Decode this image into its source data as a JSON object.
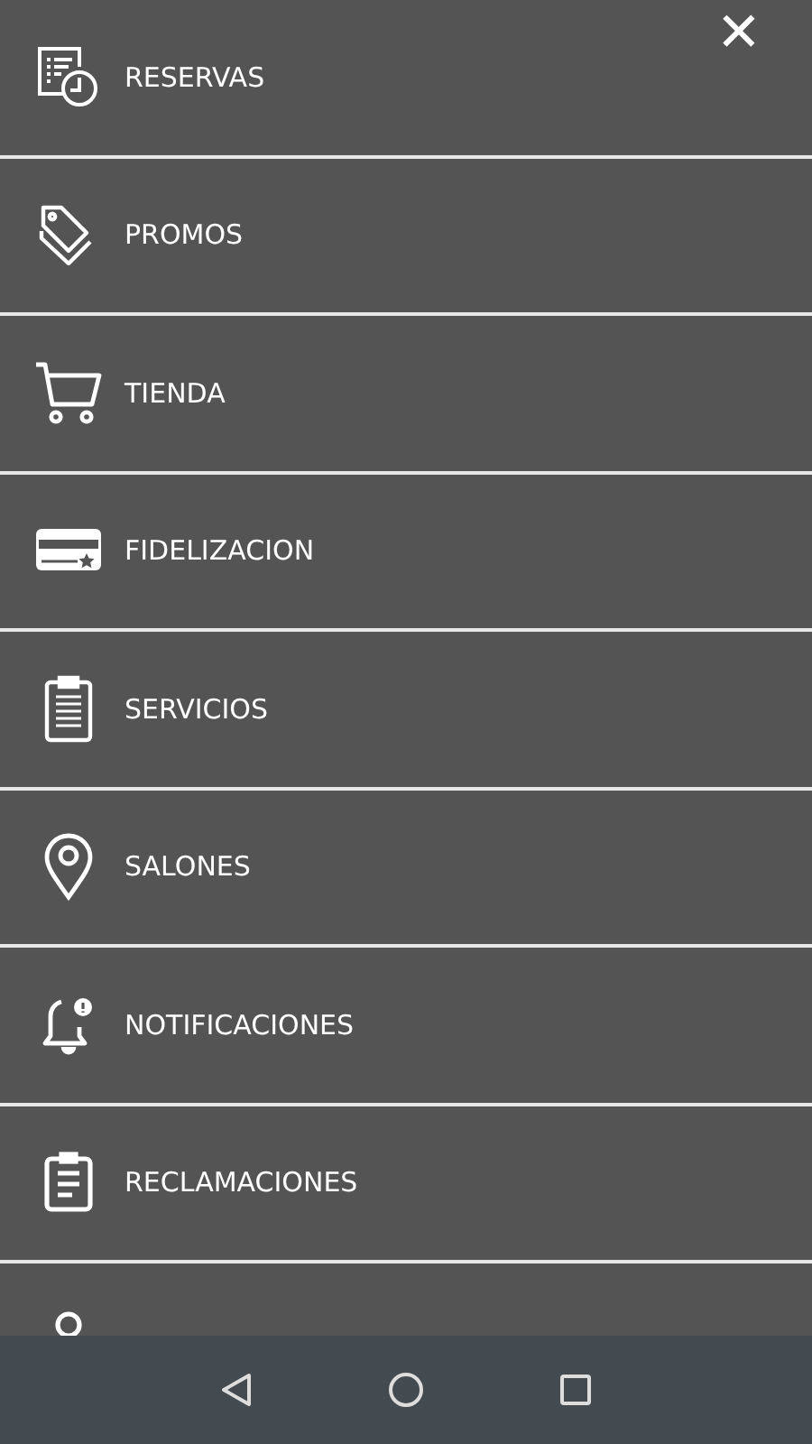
{
  "close_button": {
    "label": "✕"
  },
  "menu": {
    "items": [
      {
        "label": "RESERVAS"
      },
      {
        "label": "PROMOS"
      },
      {
        "label": "TIENDA"
      },
      {
        "label": "FIDELIZACION"
      },
      {
        "label": "SERVICIOS"
      },
      {
        "label": "SALONES"
      },
      {
        "label": "NOTIFICACIONES"
      },
      {
        "label": "RECLAMACIONES"
      }
    ]
  }
}
